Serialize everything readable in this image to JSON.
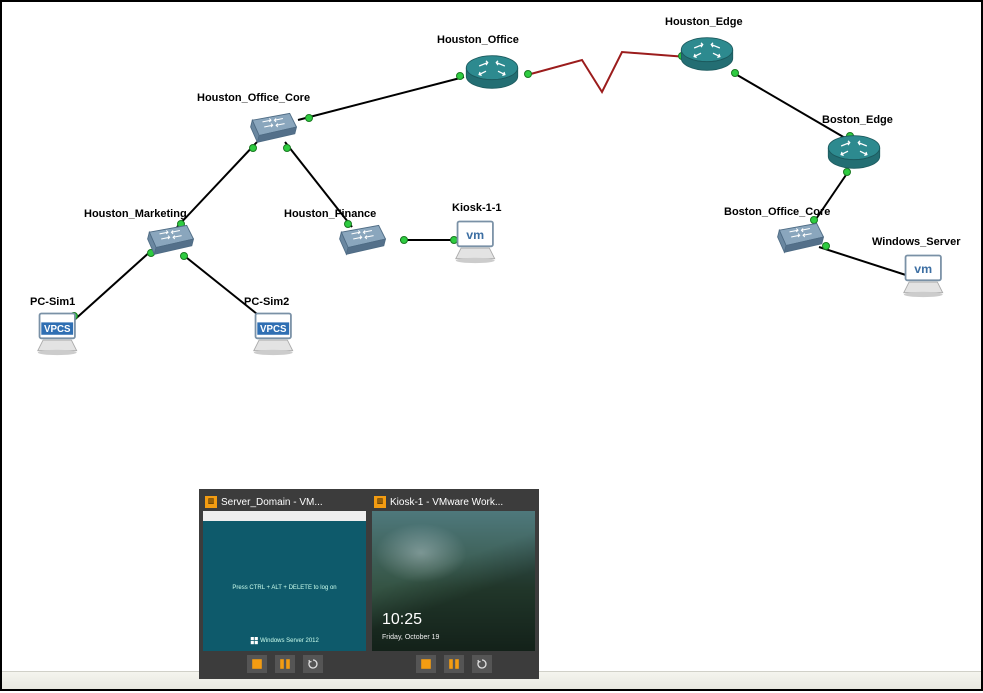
{
  "nodes": {
    "houston_office_core": {
      "label": "Houston_Office_Core",
      "type": "switch"
    },
    "houston_office": {
      "label": "Houston_Office",
      "type": "router"
    },
    "houston_edge": {
      "label": "Houston_Edge",
      "type": "router"
    },
    "boston_edge": {
      "label": "Boston_Edge",
      "type": "router"
    },
    "boston_office_core": {
      "label": "Boston_Office_Core",
      "type": "switch"
    },
    "houston_marketing": {
      "label": "Houston_Marketing",
      "type": "switch"
    },
    "houston_finance": {
      "label": "Houston_Finance",
      "type": "switch"
    },
    "kiosk": {
      "label": "Kiosk-1-1",
      "type": "vm"
    },
    "windows_server": {
      "label": "Windows_Server",
      "type": "vm"
    },
    "pc_sim1": {
      "label": "PC-Sim1",
      "type": "vpcs",
      "badge": "VPCS"
    },
    "pc_sim2": {
      "label": "PC-Sim2",
      "type": "vpcs",
      "badge": "VPCS"
    }
  },
  "links": [
    {
      "from": "houston_office_core",
      "to": "houston_office",
      "style": "ethernet"
    },
    {
      "from": "houston_office",
      "to": "houston_edge",
      "style": "serial"
    },
    {
      "from": "houston_edge",
      "to": "boston_edge",
      "style": "ethernet"
    },
    {
      "from": "boston_edge",
      "to": "boston_office_core",
      "style": "ethernet"
    },
    {
      "from": "boston_office_core",
      "to": "windows_server",
      "style": "ethernet"
    },
    {
      "from": "houston_office_core",
      "to": "houston_marketing",
      "style": "ethernet"
    },
    {
      "from": "houston_office_core",
      "to": "houston_finance",
      "style": "ethernet"
    },
    {
      "from": "houston_finance",
      "to": "kiosk",
      "style": "ethernet"
    },
    {
      "from": "houston_marketing",
      "to": "pc_sim1",
      "style": "ethernet"
    },
    {
      "from": "houston_marketing",
      "to": "pc_sim2",
      "style": "ethernet"
    }
  ],
  "colors": {
    "router_fill": "#2d8a8f",
    "router_stroke": "#1c5a5e",
    "switch_fill": "#8aa6bd",
    "switch_stroke": "#4e6b84",
    "link": "#000000",
    "serial_link": "#9b1c1c",
    "port": "#2ecc40"
  },
  "vm_badge_text": "vm",
  "taskbar_previews": [
    {
      "title": "Server_Domain - VM...",
      "kind": "server",
      "lock_text": "Press CTRL + ALT + DELETE to log on",
      "branding": "Windows Server 2012",
      "controls": [
        "play",
        "pause",
        "restart"
      ]
    },
    {
      "title": "Kiosk-1 - VMware Work...",
      "kind": "kiosk",
      "clock": "10:25",
      "date": "Friday, October 19",
      "controls": [
        "play",
        "pause",
        "restart"
      ]
    }
  ]
}
